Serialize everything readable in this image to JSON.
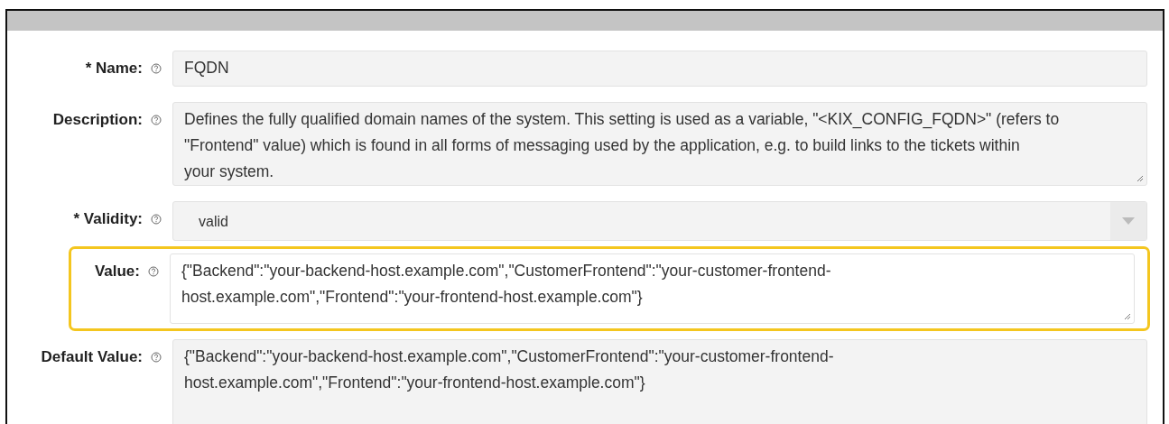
{
  "fields": [
    {
      "label": "* Name:",
      "kind": "text",
      "readonly": true,
      "highlighted": false,
      "lines": [
        "FQDN"
      ]
    },
    {
      "label": "Description:",
      "kind": "textarea",
      "readonly": true,
      "highlighted": false,
      "lines": [
        "Defines the fully qualified domain names of the system. This setting is used as a variable, \"<KIX_CONFIG_FQDN>\" (refers to",
        "\"Frontend\" value) which is found in all forms of messaging used by the application, e.g. to build links to the tickets within",
        "your system."
      ]
    },
    {
      "label": "* Validity:",
      "kind": "select",
      "readonly": true,
      "highlighted": false,
      "lines": [
        "valid"
      ]
    },
    {
      "label": "Value:",
      "kind": "textarea",
      "readonly": false,
      "highlighted": true,
      "lines": [
        "{\"Backend\":\"your-backend-host.example.com\",\"CustomerFrontend\":\"your-customer-frontend-",
        "host.example.com\",\"Frontend\":\"your-frontend-host.example.com\"}"
      ]
    },
    {
      "label": "Default Value:",
      "kind": "textarea",
      "readonly": true,
      "highlighted": false,
      "lines": [
        "{\"Backend\":\"your-backend-host.example.com\",\"CustomerFrontend\":\"your-customer-frontend-",
        "host.example.com\",\"Frontend\":\"your-frontend-host.example.com\"}"
      ]
    }
  ]
}
